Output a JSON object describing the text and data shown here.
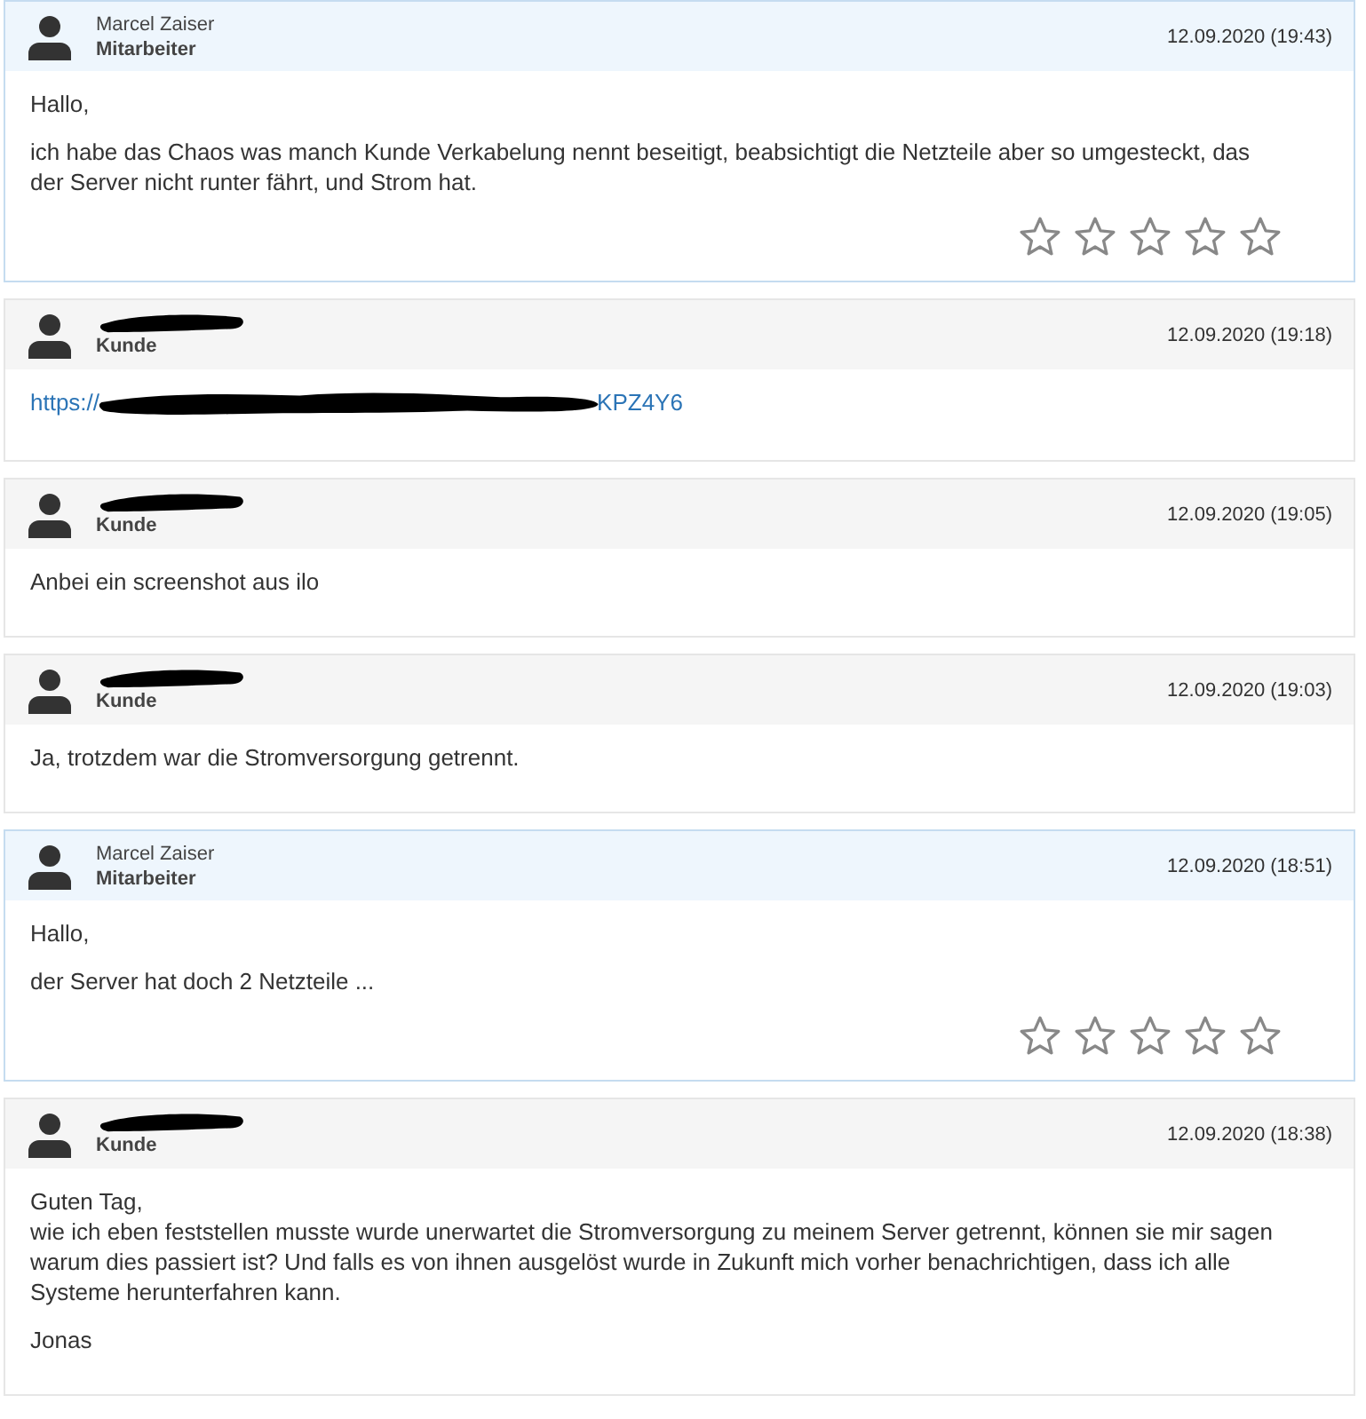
{
  "messages": [
    {
      "kind": "staff",
      "name": "Marcel Zaiser",
      "role": "Mitarbeiter",
      "date": "12.09.2020 (19:43)",
      "body": [
        {
          "kind": "text",
          "text": "Hallo,"
        },
        {
          "kind": "text",
          "text": "ich habe das Chaos was manch Kunde Verkabelung nennt beseitigt, beabsichtigt die Netzteile aber so umgesteckt, das der Server nicht runter fährt, und Strom hat."
        }
      ],
      "rating": {
        "stars": 0
      }
    },
    {
      "kind": "customer",
      "redacted": true,
      "role": "Kunde",
      "date": "12.09.2020 (19:18)",
      "body": [
        {
          "kind": "link",
          "start": "https://",
          "end": "KPZ4Y6"
        }
      ]
    },
    {
      "kind": "customer",
      "redacted": true,
      "role": "Kunde",
      "date": "12.09.2020 (19:05)",
      "body": [
        {
          "kind": "text",
          "text": "Anbei ein screenshot aus ilo"
        }
      ]
    },
    {
      "kind": "customer",
      "redacted": true,
      "role": "Kunde",
      "date": "12.09.2020 (19:03)",
      "body": [
        {
          "kind": "text",
          "text": "Ja, trotzdem war die Stromversorgung getrennt."
        }
      ]
    },
    {
      "kind": "staff",
      "name": "Marcel Zaiser",
      "role": "Mitarbeiter",
      "date": "12.09.2020 (18:51)",
      "body": [
        {
          "kind": "text",
          "text": "Hallo,"
        },
        {
          "kind": "text",
          "text": "der Server hat doch 2 Netzteile ..."
        }
      ],
      "rating": {
        "stars": 0
      }
    },
    {
      "kind": "customer",
      "redacted": true,
      "role": "Kunde",
      "date": "12.09.2020 (18:38)",
      "body": [
        {
          "kind": "text",
          "text": "Guten Tag,\nwie ich eben feststellen musste wurde unerwartet die Stromversorgung zu meinem Server getrennt, können sie mir sagen warum dies passiert ist? Und falls es von ihnen ausgelöst wurde in Zukunft mich vorher benachrichtigen, dass ich alle Systeme herunterfahren kann."
        },
        {
          "kind": "text",
          "text": "Jonas"
        }
      ]
    }
  ]
}
